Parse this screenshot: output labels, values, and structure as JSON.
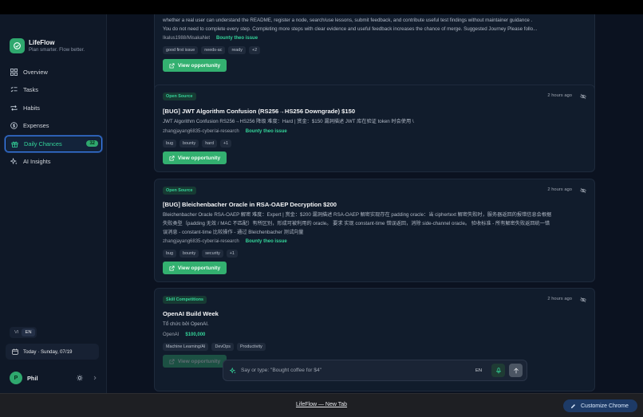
{
  "app": {
    "name": "LifeFlow",
    "tagline": "Plan smarter. Flow better."
  },
  "nav": [
    {
      "label": "Overview",
      "icon": "grid-icon"
    },
    {
      "label": "Tasks",
      "icon": "checklist-icon"
    },
    {
      "label": "Habits",
      "icon": "repeat-icon"
    },
    {
      "label": "Expenses",
      "icon": "dollar-icon"
    },
    {
      "label": "Daily Chances",
      "icon": "gift-icon",
      "badge": "32",
      "active": true
    },
    {
      "label": "AI Insights",
      "icon": "sparkles-icon"
    }
  ],
  "lang_toggle": {
    "vi": "VI",
    "en": "EN",
    "selected": "EN"
  },
  "today": "Today · Sunday, 07/19",
  "user": {
    "initial": "P",
    "name": "Phil"
  },
  "cards": [
    {
      "desc_lines": [
        "whether a real user can understand the README, register a node, search/use lessons, submit feedback, and contribute useful test findings without maintainer guidance .",
        "You do not need to complete every step. Completing more steps with clear evidence and useful feedback increases the chance of merge. Suggested Journey Please follo..."
      ],
      "repo": "Ikalus1988/MisakaNet",
      "bounty_label": "Bounty theo issue",
      "tags": [
        "good first issue",
        "needs-ac",
        "ready",
        "+2"
      ],
      "button": "View opportunity"
    },
    {
      "category": "Open Source",
      "time": "2 hours ago",
      "title": "[BUG] JWT Algorithm Confusion (RS256→HS256 Downgrade) $150",
      "desc_lines": [
        "JWT Algorithm Confusion RS256→HS256 降级 难度：Hard | 赏金：$150 漏洞描述 JWT 库在验证 token 时会使用 \\"
      ],
      "repo": "zhangjayang6835-cyber/ai-research",
      "bounty_label": "Bounty theo issue",
      "tags": [
        "bug",
        "bounty",
        "hard",
        "+1"
      ],
      "button": "View opportunity"
    },
    {
      "category": "Open Source",
      "time": "2 hours ago",
      "title": "[BUG] Bleichenbacher Oracle in RSA-OAEP Decryption $200",
      "desc_lines": [
        "Bleichenbacher Oracle RSA-OAEP 解密 难度：Expert | 赏金：$200 漏洞描述 RSA-OAEP 解密实现存在 padding oracle：当 ciphertext 解密失败时，服务器返回的报错信息会根据",
        "失败类型（padding 无效 / MAC 不匹配）有所区别，形成可被利用的 oracle。 要求 实现 constant-time 错误返回，消除 side-channel oracle。 验收标准 - 所有解密失败返回统一错",
        "误消息 - constant-time 比较操作 - 通过 Bleichenbacher 测试向量"
      ],
      "repo": "zhangjayang6835-cyber/ai-research",
      "bounty_label": "Bounty theo issue",
      "tags": [
        "bug",
        "bounty",
        "security",
        "+1"
      ],
      "button": "View opportunity"
    },
    {
      "category": "Skill Competitions",
      "time": "2 hours ago",
      "title": "OpenAI Build Week",
      "subtitle": "Tổ chức bởi OpenAI.",
      "org": "OpenAI",
      "prize": "$100,000",
      "tags": [
        "Machine Learning/AI",
        "DevOps",
        "Productivity"
      ],
      "button": "View opportunity"
    }
  ],
  "chat": {
    "placeholder": "Say or type: \"Bought coffee for $4\"",
    "lang": "EN"
  },
  "browser": {
    "tab_title": "LifeFlow — New Tab",
    "customize_label": "Customize Chrome"
  },
  "colors": {
    "accent": "#34d399",
    "button": "#33b070",
    "active_border": "#3b82f6",
    "background": "#0b1220"
  }
}
